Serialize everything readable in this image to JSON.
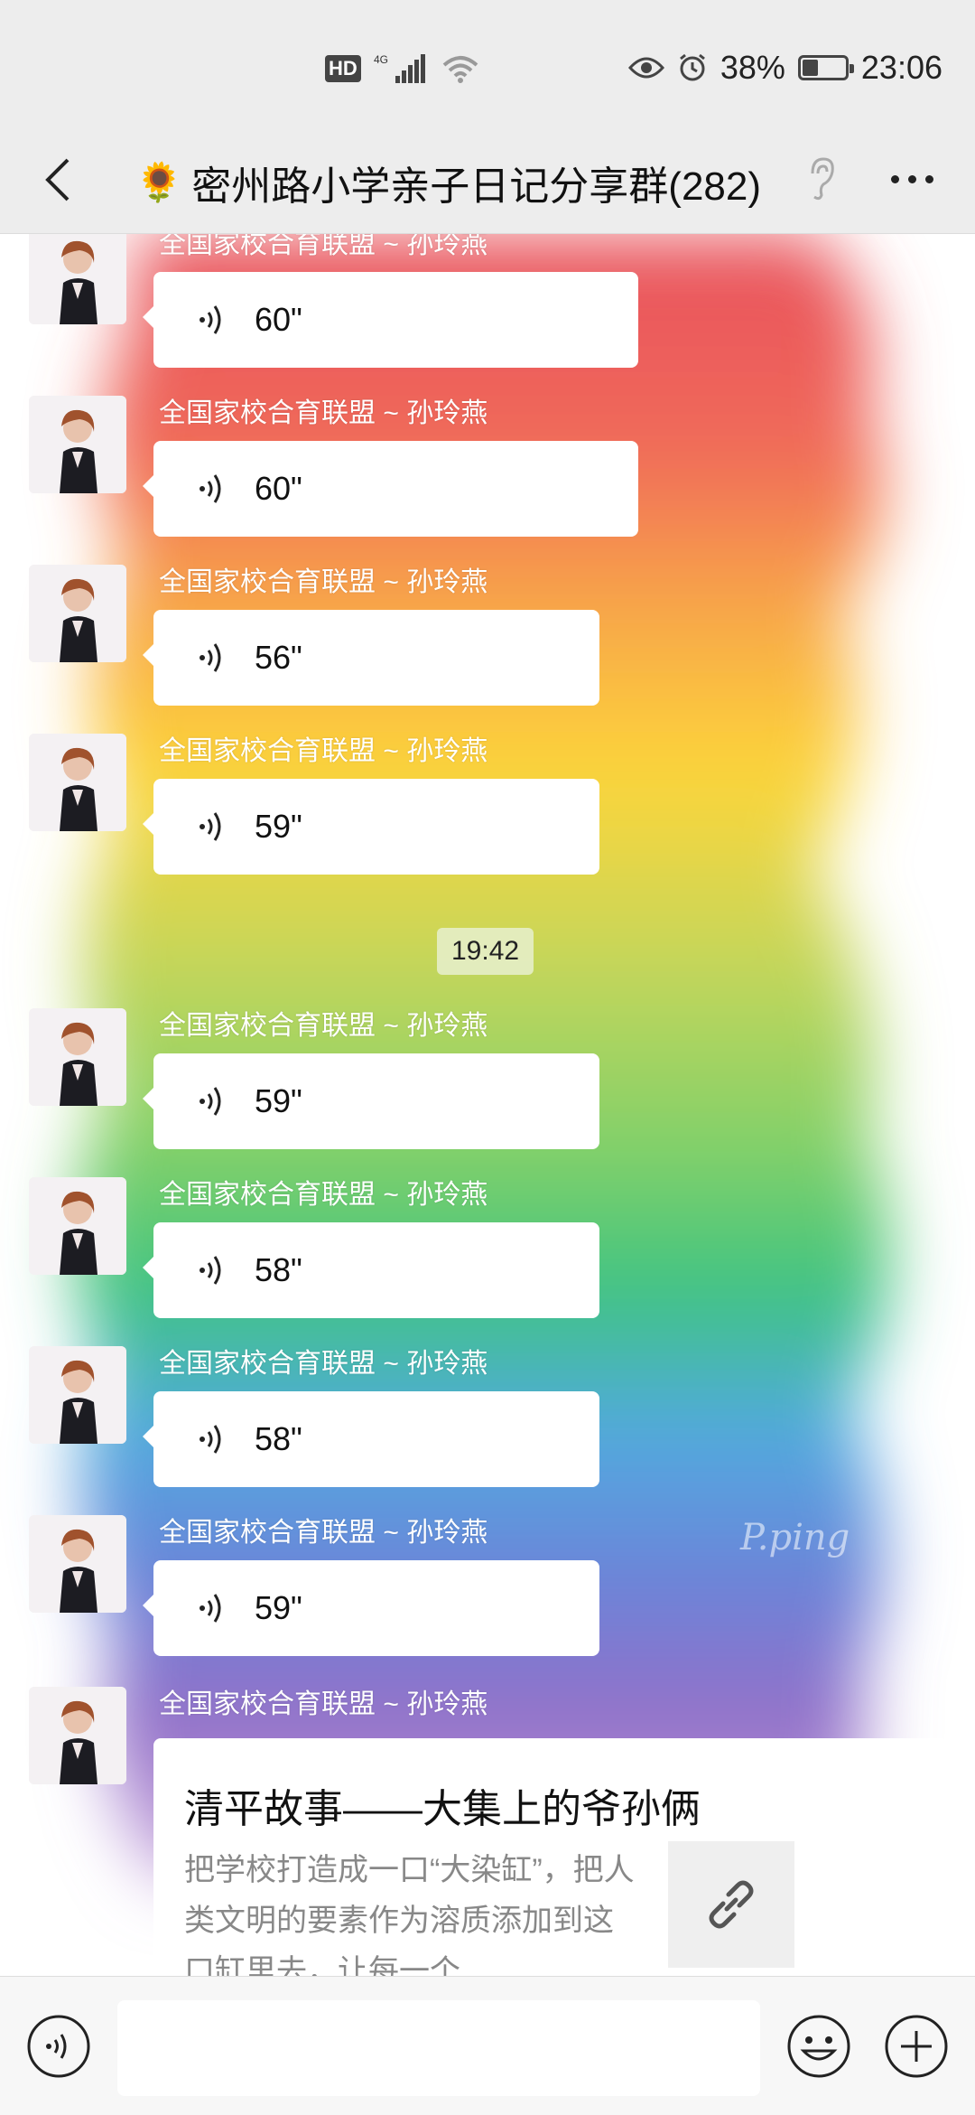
{
  "status_bar": {
    "hd": "HD",
    "network": "4G",
    "battery_percent": "38%",
    "battery_level": 0.38,
    "time": "23:06"
  },
  "header": {
    "emoji": "🌻",
    "title": "密州路小学亲子日记分享群(282)"
  },
  "colors": {
    "bar_bg": "#ededed",
    "bubble_bg": "#ffffff",
    "time_badge_bg": "#e6eec8"
  },
  "messages": [
    {
      "sender": "全国家校合育联盟 ~ 孙玲燕",
      "duration": "60\""
    },
    {
      "sender": "全国家校合育联盟 ~ 孙玲燕",
      "duration": "60\""
    },
    {
      "sender": "全国家校合育联盟 ~ 孙玲燕",
      "duration": "56\""
    },
    {
      "sender": "全国家校合育联盟 ~ 孙玲燕",
      "duration": "59\""
    },
    {
      "sender": "全国家校合育联盟 ~ 孙玲燕",
      "duration": "59\""
    },
    {
      "sender": "全国家校合育联盟 ~ 孙玲燕",
      "duration": "58\""
    },
    {
      "sender": "全国家校合育联盟 ~ 孙玲燕",
      "duration": "58\""
    },
    {
      "sender": "全国家校合育联盟 ~ 孙玲燕",
      "duration": "59\""
    }
  ],
  "time_separator": "19:42",
  "link_message": {
    "sender": "全国家校合育联盟 ~ 孙玲燕",
    "title": "清平故事——大集上的爷孙俩",
    "description": "把学校打造成一口“大染缸”，把人类文明的要素作为溶质添加到这口缸里去，让每一个..."
  },
  "watermark": "P.ping",
  "icons": {
    "back": "chevron-left-icon",
    "ear": "ear-icon",
    "more": "more-dots-icon",
    "voice": "voice-wave-icon",
    "link": "link-icon",
    "emoji": "smiley-icon",
    "plus": "plus-icon"
  }
}
